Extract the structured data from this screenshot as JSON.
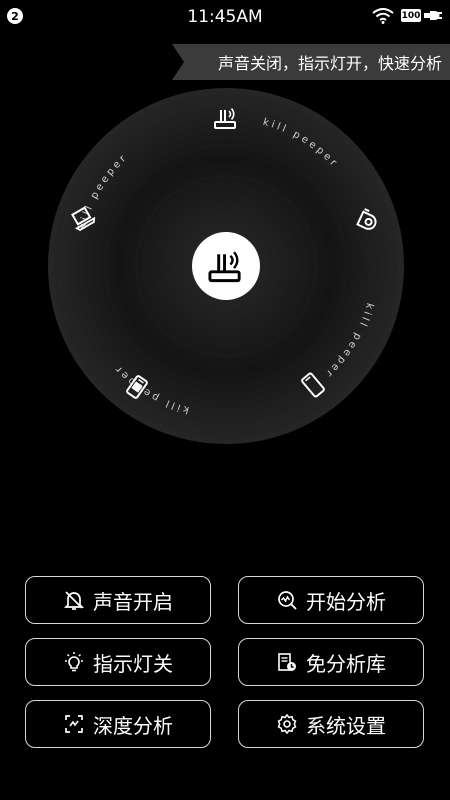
{
  "status_bar": {
    "time": "11:45AM",
    "notification_count": "2",
    "battery": "100"
  },
  "banner": {
    "text": "声音关闭，指示灯开，快速分析"
  },
  "disc": {
    "ring_text": "kill peeper"
  },
  "buttons": {
    "sound": "声音开启",
    "start_analysis": "开始分析",
    "indicator": "指示灯关",
    "whitelist": "免分析库",
    "deep_analysis": "深度分析",
    "settings": "系统设置"
  },
  "colors": {
    "background": "#000000",
    "disc": "#1a1a1a",
    "banner": "#3b3b3b",
    "button_border": "#d8d8d8"
  },
  "icons": [
    "wifi-icon",
    "battery-icon",
    "router-icon",
    "laptop-icon",
    "camera-icon",
    "tablet-icon",
    "phone-icon",
    "bell-off-icon",
    "magnifier-chart-icon",
    "bulb-icon",
    "database-icon",
    "scan-icon",
    "gear-icon"
  ]
}
